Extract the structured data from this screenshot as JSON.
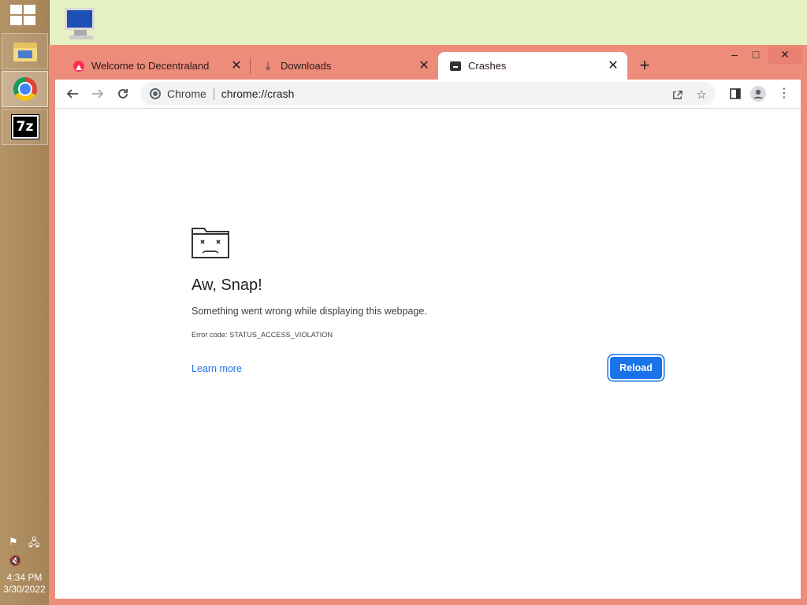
{
  "taskbar": {
    "apps": [
      {
        "name": "File Explorer"
      },
      {
        "name": "Google Chrome"
      },
      {
        "name": "7-Zip"
      }
    ],
    "clock": {
      "time": "4:34 PM",
      "date": "3/30/2022"
    }
  },
  "browser": {
    "tabs": [
      {
        "title": "Welcome to Decentraland",
        "icon": "decentraland-icon",
        "active": false
      },
      {
        "title": "Downloads",
        "icon": "download-icon",
        "active": false
      },
      {
        "title": "Crashes",
        "icon": "crash-icon",
        "active": true
      }
    ],
    "new_tab_label": "+",
    "omnibox": {
      "site_name": "Chrome",
      "url": "chrome://crash"
    },
    "window_controls": {
      "minimize": "–",
      "maximize": "□",
      "close": "✕"
    }
  },
  "error_page": {
    "title": "Aw, Snap!",
    "message": "Something went wrong while displaying this webpage.",
    "error_code": "Error code: STATUS_ACCESS_VIOLATION",
    "learn_more": "Learn more",
    "reload_label": "Reload"
  },
  "colors": {
    "window_frame": "#ee8c7c",
    "accent_blue": "#1a73e8",
    "taskbar": "#a58357"
  }
}
